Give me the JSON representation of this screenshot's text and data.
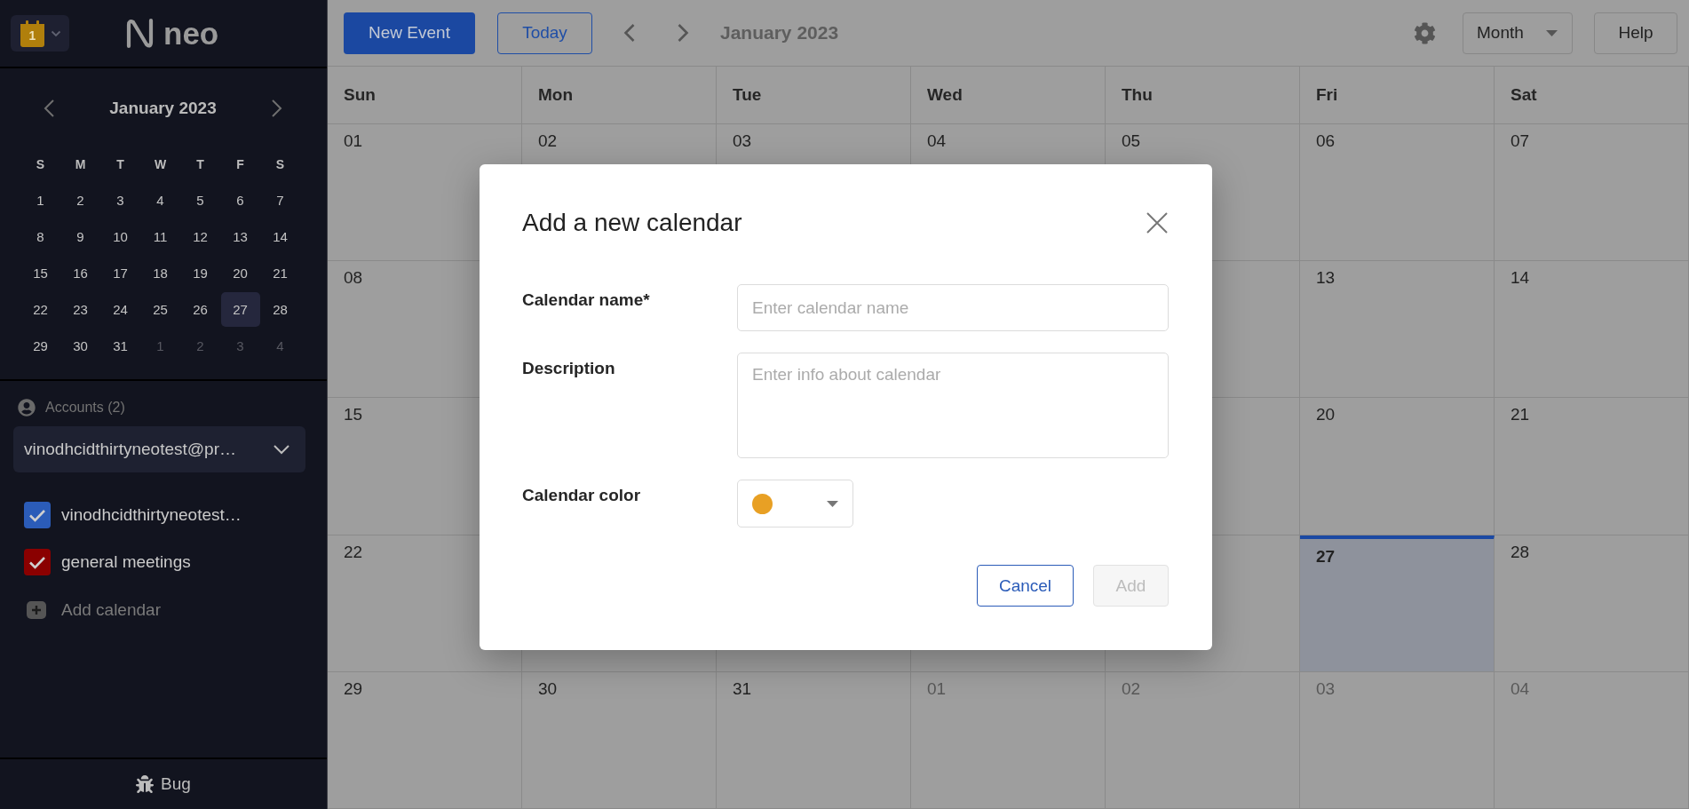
{
  "sidebar": {
    "app_switcher": {
      "date": "1"
    },
    "logo": "neo",
    "mini_calendar": {
      "title": "January 2023",
      "weekdays": [
        "S",
        "M",
        "T",
        "W",
        "T",
        "F",
        "S"
      ],
      "weeks": [
        [
          {
            "day": "1",
            "outside": false,
            "selected": false
          },
          {
            "day": "2",
            "outside": false,
            "selected": false
          },
          {
            "day": "3",
            "outside": false,
            "selected": false
          },
          {
            "day": "4",
            "outside": false,
            "selected": false
          },
          {
            "day": "5",
            "outside": false,
            "selected": false
          },
          {
            "day": "6",
            "outside": false,
            "selected": false
          },
          {
            "day": "7",
            "outside": false,
            "selected": false
          }
        ],
        [
          {
            "day": "8",
            "outside": false,
            "selected": false
          },
          {
            "day": "9",
            "outside": false,
            "selected": false
          },
          {
            "day": "10",
            "outside": false,
            "selected": false
          },
          {
            "day": "11",
            "outside": false,
            "selected": false
          },
          {
            "day": "12",
            "outside": false,
            "selected": false
          },
          {
            "day": "13",
            "outside": false,
            "selected": false
          },
          {
            "day": "14",
            "outside": false,
            "selected": false
          }
        ],
        [
          {
            "day": "15",
            "outside": false,
            "selected": false
          },
          {
            "day": "16",
            "outside": false,
            "selected": false
          },
          {
            "day": "17",
            "outside": false,
            "selected": false
          },
          {
            "day": "18",
            "outside": false,
            "selected": false
          },
          {
            "day": "19",
            "outside": false,
            "selected": false
          },
          {
            "day": "20",
            "outside": false,
            "selected": false
          },
          {
            "day": "21",
            "outside": false,
            "selected": false
          }
        ],
        [
          {
            "day": "22",
            "outside": false,
            "selected": false
          },
          {
            "day": "23",
            "outside": false,
            "selected": false
          },
          {
            "day": "24",
            "outside": false,
            "selected": false
          },
          {
            "day": "25",
            "outside": false,
            "selected": false
          },
          {
            "day": "26",
            "outside": false,
            "selected": false
          },
          {
            "day": "27",
            "outside": false,
            "selected": true
          },
          {
            "day": "28",
            "outside": false,
            "selected": false
          }
        ],
        [
          {
            "day": "29",
            "outside": false,
            "selected": false
          },
          {
            "day": "30",
            "outside": false,
            "selected": false
          },
          {
            "day": "31",
            "outside": false,
            "selected": false
          },
          {
            "day": "1",
            "outside": true,
            "selected": false
          },
          {
            "day": "2",
            "outside": true,
            "selected": false
          },
          {
            "day": "3",
            "outside": true,
            "selected": false
          },
          {
            "day": "4",
            "outside": true,
            "selected": false
          }
        ]
      ]
    },
    "accounts": {
      "label": "Accounts (2)",
      "current": "vinodhcidthirtyneotest@pr…"
    },
    "calendars": [
      {
        "name": "vinodhcidthirtyneotest…",
        "checked": true,
        "color": "#2b5cb8"
      },
      {
        "name": "general meetings",
        "checked": true,
        "color": "#8a0000"
      }
    ],
    "add_calendar": "Add calendar",
    "footer": "Bug"
  },
  "toolbar": {
    "new_event": "New Event",
    "today": "Today",
    "title": "January 2023",
    "view": "Month",
    "help": "Help"
  },
  "month_grid": {
    "weekdays": [
      "Sun",
      "Mon",
      "Tue",
      "Wed",
      "Thu",
      "Fri",
      "Sat"
    ],
    "weeks": [
      {
        "sun": {
          "day": "01",
          "outside": false,
          "today": false
        },
        "mon": {
          "day": "02",
          "outside": false,
          "today": false
        },
        "tue": {
          "day": "03",
          "outside": false,
          "today": false
        },
        "wed": {
          "day": "04",
          "outside": false,
          "today": false
        },
        "thu": {
          "day": "05",
          "outside": false,
          "today": false
        },
        "fri": {
          "day": "06",
          "outside": false,
          "today": false
        },
        "sat": {
          "day": "07",
          "outside": false,
          "today": false
        }
      },
      {
        "sun": {
          "day": "08",
          "outside": false,
          "today": false
        },
        "fri": {
          "day": "13",
          "outside": false,
          "today": false
        },
        "sat": {
          "day": "14",
          "outside": false,
          "today": false
        }
      },
      {
        "sun": {
          "day": "15",
          "outside": false,
          "today": false
        },
        "fri": {
          "day": "20",
          "outside": false,
          "today": false
        },
        "sat": {
          "day": "21",
          "outside": false,
          "today": false
        }
      },
      {
        "sun": {
          "day": "22",
          "outside": false,
          "today": false
        },
        "fri": {
          "day": "27",
          "outside": false,
          "today": true
        },
        "sat": {
          "day": "28",
          "outside": false,
          "today": false
        }
      },
      {
        "sun": {
          "day": "29",
          "outside": false,
          "today": false
        },
        "mon": {
          "day": "30",
          "outside": false,
          "today": false
        },
        "tue": {
          "day": "31",
          "outside": false,
          "today": false
        },
        "wed": {
          "day": "01",
          "outside": true,
          "today": false
        },
        "thu": {
          "day": "02",
          "outside": true,
          "today": false
        },
        "fri": {
          "day": "03",
          "outside": true,
          "today": false
        },
        "sat": {
          "day": "04",
          "outside": true,
          "today": false
        }
      }
    ]
  },
  "dialog": {
    "title": "Add a new calendar",
    "fields": [
      {
        "kind": "text",
        "label": "Calendar name*",
        "placeholder": "Enter calendar name"
      },
      {
        "kind": "textarea",
        "label": "Description",
        "placeholder": "Enter info about calendar"
      },
      {
        "kind": "color",
        "label": "Calendar color",
        "color": "#e8a024"
      }
    ],
    "buttons": [
      {
        "label": "Cancel",
        "kind": "outline",
        "disabled": false
      },
      {
        "label": "Add",
        "kind": "solid",
        "disabled": true
      }
    ]
  }
}
